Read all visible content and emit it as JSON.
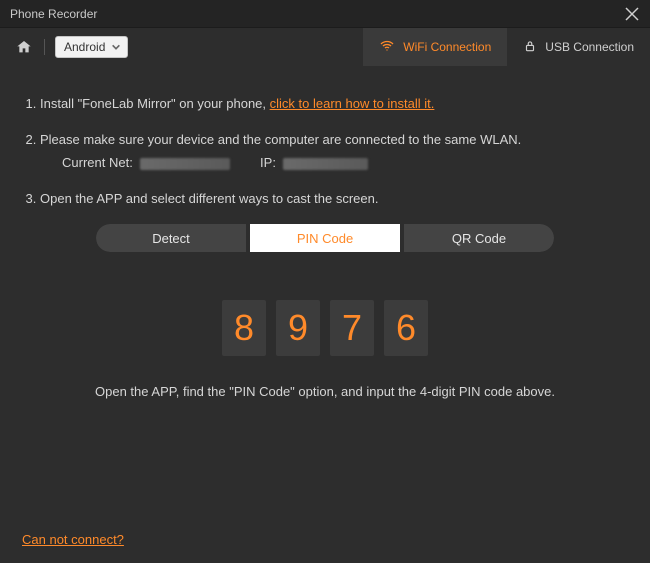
{
  "window": {
    "title": "Phone Recorder"
  },
  "toolbar": {
    "device_label": "Android",
    "wifi_tab": "WiFi Connection",
    "usb_tab": "USB Connection"
  },
  "steps": {
    "s1_prefix": "Install \"FoneLab Mirror\" on your phone, ",
    "s1_link": "click to learn how to install it.",
    "s2": "Please make sure your device and the computer are connected to the same WLAN.",
    "s2_net_label": "Current Net:",
    "s2_ip_label": "IP:",
    "s3": "Open the APP and select different ways to cast the screen."
  },
  "segmented": {
    "detect": "Detect",
    "pincode": "PIN Code",
    "qrcode": "QR Code"
  },
  "pin": {
    "d1": "8",
    "d2": "9",
    "d3": "7",
    "d4": "6"
  },
  "hint": "Open the APP, find the \"PIN Code\" option, and input the 4-digit PIN code above.",
  "footer": {
    "cannot_connect": "Can not connect?"
  }
}
